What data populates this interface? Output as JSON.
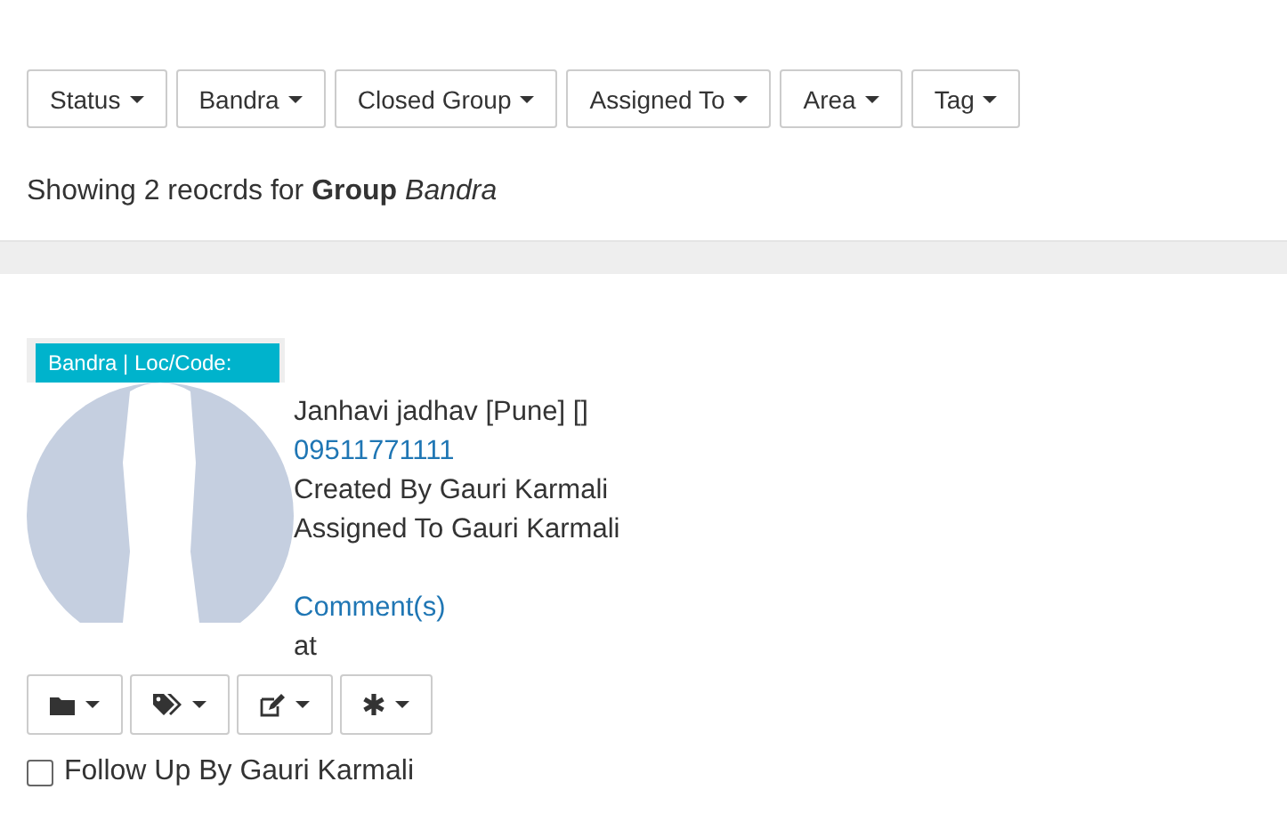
{
  "filters": [
    {
      "label": "Status"
    },
    {
      "label": "Bandra"
    },
    {
      "label": "Closed Group"
    },
    {
      "label": "Assigned To"
    },
    {
      "label": "Area"
    },
    {
      "label": "Tag"
    }
  ],
  "summary": "Showing 2 reocrds for **Group** *Bandra*",
  "record": {
    "badge": "Bandra | Loc/Code:",
    "name": "Janhavi jadhav [Pune] []",
    "phone": "09511771111",
    "created_by": "Created By Gauri Karmali",
    "assigned_to": "Assigned To Gauri Karmali",
    "comments_link": "Comment(s)",
    "at": "at",
    "actions": [
      {
        "kind": "folder"
      },
      {
        "kind": "tags"
      },
      {
        "kind": "edit"
      },
      {
        "kind": "asterisk"
      }
    ],
    "follow_up": {
      "label": "Follow Up By Gauri Karmali",
      "checked": false
    }
  }
}
